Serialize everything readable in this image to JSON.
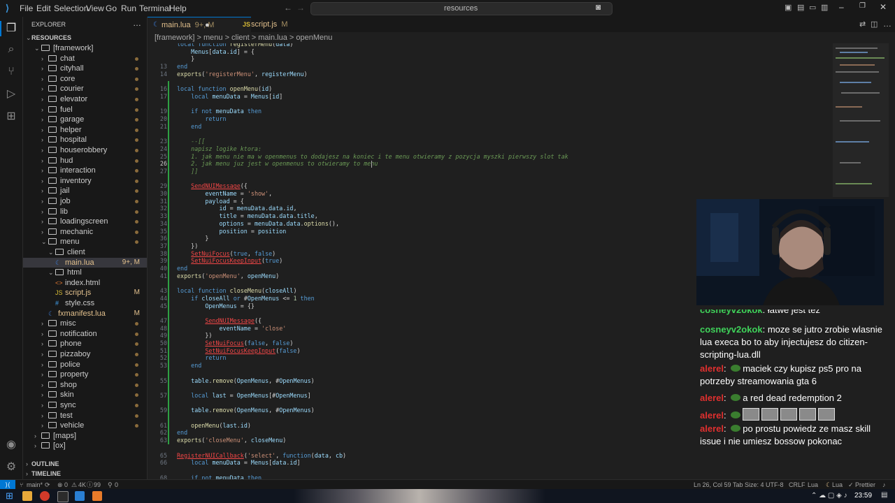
{
  "titlebar": {
    "menus": [
      "File",
      "Edit",
      "Selection",
      "View",
      "Go",
      "Run",
      "Terminal",
      "Help"
    ],
    "search_text": "resources"
  },
  "explorer": {
    "header": "EXPLORER",
    "section": "RESOURCES",
    "items": [
      {
        "label": "[framework]",
        "indent": 1,
        "open": true,
        "folder": true
      },
      {
        "label": "chat",
        "indent": 2,
        "folder": true
      },
      {
        "label": "cityhall",
        "indent": 2,
        "folder": true
      },
      {
        "label": "core",
        "indent": 2,
        "folder": true
      },
      {
        "label": "courier",
        "indent": 2,
        "folder": true
      },
      {
        "label": "elevator",
        "indent": 2,
        "folder": true
      },
      {
        "label": "fuel",
        "indent": 2,
        "folder": true
      },
      {
        "label": "garage",
        "indent": 2,
        "folder": true
      },
      {
        "label": "helper",
        "indent": 2,
        "folder": true
      },
      {
        "label": "hospital",
        "indent": 2,
        "folder": true
      },
      {
        "label": "houserobbery",
        "indent": 2,
        "folder": true
      },
      {
        "label": "hud",
        "indent": 2,
        "folder": true
      },
      {
        "label": "interaction",
        "indent": 2,
        "folder": true
      },
      {
        "label": "inventory",
        "indent": 2,
        "folder": true
      },
      {
        "label": "jail",
        "indent": 2,
        "folder": true
      },
      {
        "label": "job",
        "indent": 2,
        "folder": true
      },
      {
        "label": "lib",
        "indent": 2,
        "folder": true
      },
      {
        "label": "loadingscreen",
        "indent": 2,
        "folder": true
      },
      {
        "label": "mechanic",
        "indent": 2,
        "folder": true
      },
      {
        "label": "menu",
        "indent": 2,
        "open": true,
        "folder": true
      },
      {
        "label": "client",
        "indent": 3,
        "open": true,
        "folder": true
      },
      {
        "label": "main.lua",
        "indent": 4,
        "badge": "9+, M",
        "selected": true
      },
      {
        "label": "html",
        "indent": 3,
        "open": true,
        "folder": true
      },
      {
        "label": "index.html",
        "indent": 4
      },
      {
        "label": "script.js",
        "indent": 4,
        "badge": "M"
      },
      {
        "label": "style.css",
        "indent": 4
      },
      {
        "label": "fxmanifest.lua",
        "indent": 3,
        "badge": "M"
      },
      {
        "label": "misc",
        "indent": 2,
        "folder": true
      },
      {
        "label": "notification",
        "indent": 2,
        "folder": true
      },
      {
        "label": "phone",
        "indent": 2,
        "folder": true
      },
      {
        "label": "pizzaboy",
        "indent": 2,
        "folder": true
      },
      {
        "label": "police",
        "indent": 2,
        "folder": true
      },
      {
        "label": "property",
        "indent": 2,
        "folder": true
      },
      {
        "label": "shop",
        "indent": 2,
        "folder": true
      },
      {
        "label": "skin",
        "indent": 2,
        "folder": true
      },
      {
        "label": "sync",
        "indent": 2,
        "folder": true
      },
      {
        "label": "test",
        "indent": 2,
        "folder": true
      },
      {
        "label": "vehicle",
        "indent": 2,
        "folder": true
      },
      {
        "label": "[maps]",
        "indent": 1,
        "folder": true
      },
      {
        "label": "[ox]",
        "indent": 1,
        "folder": true
      }
    ],
    "outline": "OUTLINE",
    "timeline": "TIMELINE"
  },
  "tabs": [
    {
      "label": "main.lua",
      "badge": "9+, M",
      "active": true
    },
    {
      "label": "script.js",
      "badge": "M",
      "active": false
    }
  ],
  "breadcrumb": "[framework] > menu > client > main.lua > openMenu",
  "code": [
    {
      "n": "",
      "t": "local function registerMenu(data)"
    },
    {
      "n": "",
      "t": "    Menus[data.id] = {"
    },
    {
      "n": "",
      "t": "    }"
    },
    {
      "n": "13",
      "t": "end"
    },
    {
      "n": "14",
      "t": "exports('registerMenu', registerMenu)"
    },
    {
      "n": "",
      "t": ""
    },
    {
      "n": "16",
      "t": "local function openMenu(id)"
    },
    {
      "n": "17",
      "t": "    local menuData = Menus[id]"
    },
    {
      "n": "",
      "t": ""
    },
    {
      "n": "19",
      "t": "    if not menuData then"
    },
    {
      "n": "20",
      "t": "        return"
    },
    {
      "n": "21",
      "t": "    end"
    },
    {
      "n": "",
      "t": ""
    },
    {
      "n": "23",
      "t": "    --[["
    },
    {
      "n": "24",
      "t": "    napisz logike ktora:"
    },
    {
      "n": "25",
      "t": "    1. jak menu nie ma w openmenus to dodajesz na koniec i te menu otwieramy z pozycja myszki pierwszy slot tak"
    },
    {
      "n": "26",
      "t": "    2. jak menu juz jest w openmenus to otwieramy to menu "
    },
    {
      "n": "27",
      "t": "    ]]"
    },
    {
      "n": "",
      "t": ""
    },
    {
      "n": "29",
      "t": "    SendNUIMessage({"
    },
    {
      "n": "30",
      "t": "        eventName = 'show',"
    },
    {
      "n": "31",
      "t": "        payload = {"
    },
    {
      "n": "32",
      "t": "            id = menuData.data.id,"
    },
    {
      "n": "33",
      "t": "            title = menuData.data.title,"
    },
    {
      "n": "34",
      "t": "            options = menuData.data.options(),"
    },
    {
      "n": "35",
      "t": "            position = position"
    },
    {
      "n": "36",
      "t": "        }"
    },
    {
      "n": "37",
      "t": "    })"
    },
    {
      "n": "38",
      "t": "    SetNuiFocus(true, false)"
    },
    {
      "n": "39",
      "t": "    SetNuiFocusKeepInput(true)"
    },
    {
      "n": "40",
      "t": "end"
    },
    {
      "n": "41",
      "t": "exports('openMenu', openMenu)"
    },
    {
      "n": "",
      "t": ""
    },
    {
      "n": "43",
      "t": "local function closeMenu(closeAll)"
    },
    {
      "n": "44",
      "t": "    if closeAll or #OpenMenus <= 1 then"
    },
    {
      "n": "45",
      "t": "        OpenMenus = {}"
    },
    {
      "n": "",
      "t": ""
    },
    {
      "n": "47",
      "t": "        SendNUIMessage({"
    },
    {
      "n": "48",
      "t": "            eventName = 'close'"
    },
    {
      "n": "49",
      "t": "        })"
    },
    {
      "n": "50",
      "t": "        SetNuiFocus(false, false)"
    },
    {
      "n": "51",
      "t": "        SetNuiFocusKeepInput(false)"
    },
    {
      "n": "52",
      "t": "        return"
    },
    {
      "n": "53",
      "t": "    end"
    },
    {
      "n": "",
      "t": ""
    },
    {
      "n": "55",
      "t": "    table.remove(OpenMenus, #OpenMenus)"
    },
    {
      "n": "",
      "t": ""
    },
    {
      "n": "57",
      "t": "    local last = OpenMenus[#OpenMenus]"
    },
    {
      "n": "",
      "t": ""
    },
    {
      "n": "59",
      "t": "    table.remove(OpenMenus, #OpenMenus)"
    },
    {
      "n": "",
      "t": ""
    },
    {
      "n": "61",
      "t": "    openMenu(last.id)"
    },
    {
      "n": "62",
      "t": "end"
    },
    {
      "n": "63",
      "t": "exports('closeMenu', closeMenu)"
    },
    {
      "n": "",
      "t": ""
    },
    {
      "n": "65",
      "t": "RegisterNUICallback('select', function(data, cb)"
    },
    {
      "n": "66",
      "t": "    local menuData = Menus[data.id]"
    },
    {
      "n": "",
      "t": ""
    },
    {
      "n": "68",
      "t": "    if not menuData then"
    }
  ],
  "chat": [
    {
      "user": "cosneyv2okok",
      "color": "#3fd35a",
      "msg": "łatwe jest też",
      "partial": true
    },
    {
      "user": "cosneyv2okok",
      "color": "#3fd35a",
      "msg": "moze se jutro zrobie wlasnie lua execa bo to aby injectujesz do citizen-scripting-lua.dll"
    },
    {
      "user": "alerel",
      "color": "#e0302f",
      "emote": true,
      "msg": "maciek czy kupisz ps5 pro na potrzeby streamowania gta 6"
    },
    {
      "user": "alerel",
      "color": "#e0302f",
      "emote": true,
      "msg": "a red dead redemption 2"
    },
    {
      "user": "alerel",
      "color": "#e0302f",
      "emote": true,
      "faces": 5,
      "msg": ""
    },
    {
      "user": "alerel",
      "color": "#e0302f",
      "emote": true,
      "msg": "po prostu powiedz ze masz skill issue i nie umiesz bossow pokonac"
    }
  ],
  "statusbar": {
    "branch": "main*",
    "problems": "0",
    "warnings": "4K",
    "info": "99",
    "ports": "0",
    "position": "Ln 26, Col 59",
    "tabsize": "Tab Size: 4",
    "encoding": "UTF-8",
    "eol": "CRLF",
    "language": "Lua",
    "lua": "Lua",
    "prettier": "Prettier"
  },
  "taskbar": {
    "time": "23:59"
  },
  "colors": {
    "accent": "#0078d4",
    "modified": "#e2c08d",
    "git_added": "#2ea043"
  }
}
